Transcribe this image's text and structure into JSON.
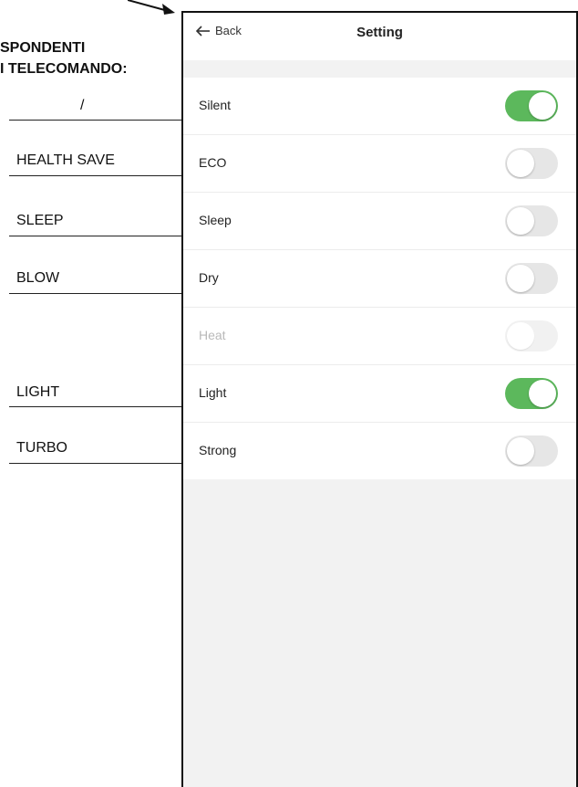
{
  "manual": {
    "header_line1": "SPONDENTI",
    "header_line2": "I TELECOMANDO:",
    "labels": [
      "/",
      "HEALTH SAVE",
      "SLEEP",
      "BLOW",
      "LIGHT",
      "TURBO"
    ]
  },
  "screen": {
    "back_label": "Back",
    "title": "Setting",
    "settings": [
      {
        "label": "Silent",
        "on": true,
        "disabled": false
      },
      {
        "label": "ECO",
        "on": false,
        "disabled": false
      },
      {
        "label": "Sleep",
        "on": false,
        "disabled": false
      },
      {
        "label": "Dry",
        "on": false,
        "disabled": false
      },
      {
        "label": "Heat",
        "on": false,
        "disabled": true
      },
      {
        "label": "Light",
        "on": true,
        "disabled": false
      },
      {
        "label": "Strong",
        "on": false,
        "disabled": false
      }
    ]
  },
  "colors": {
    "toggle_on": "#5cb85c",
    "toggle_off": "#e6e6e6",
    "screen_bg": "#f2f2f2"
  }
}
